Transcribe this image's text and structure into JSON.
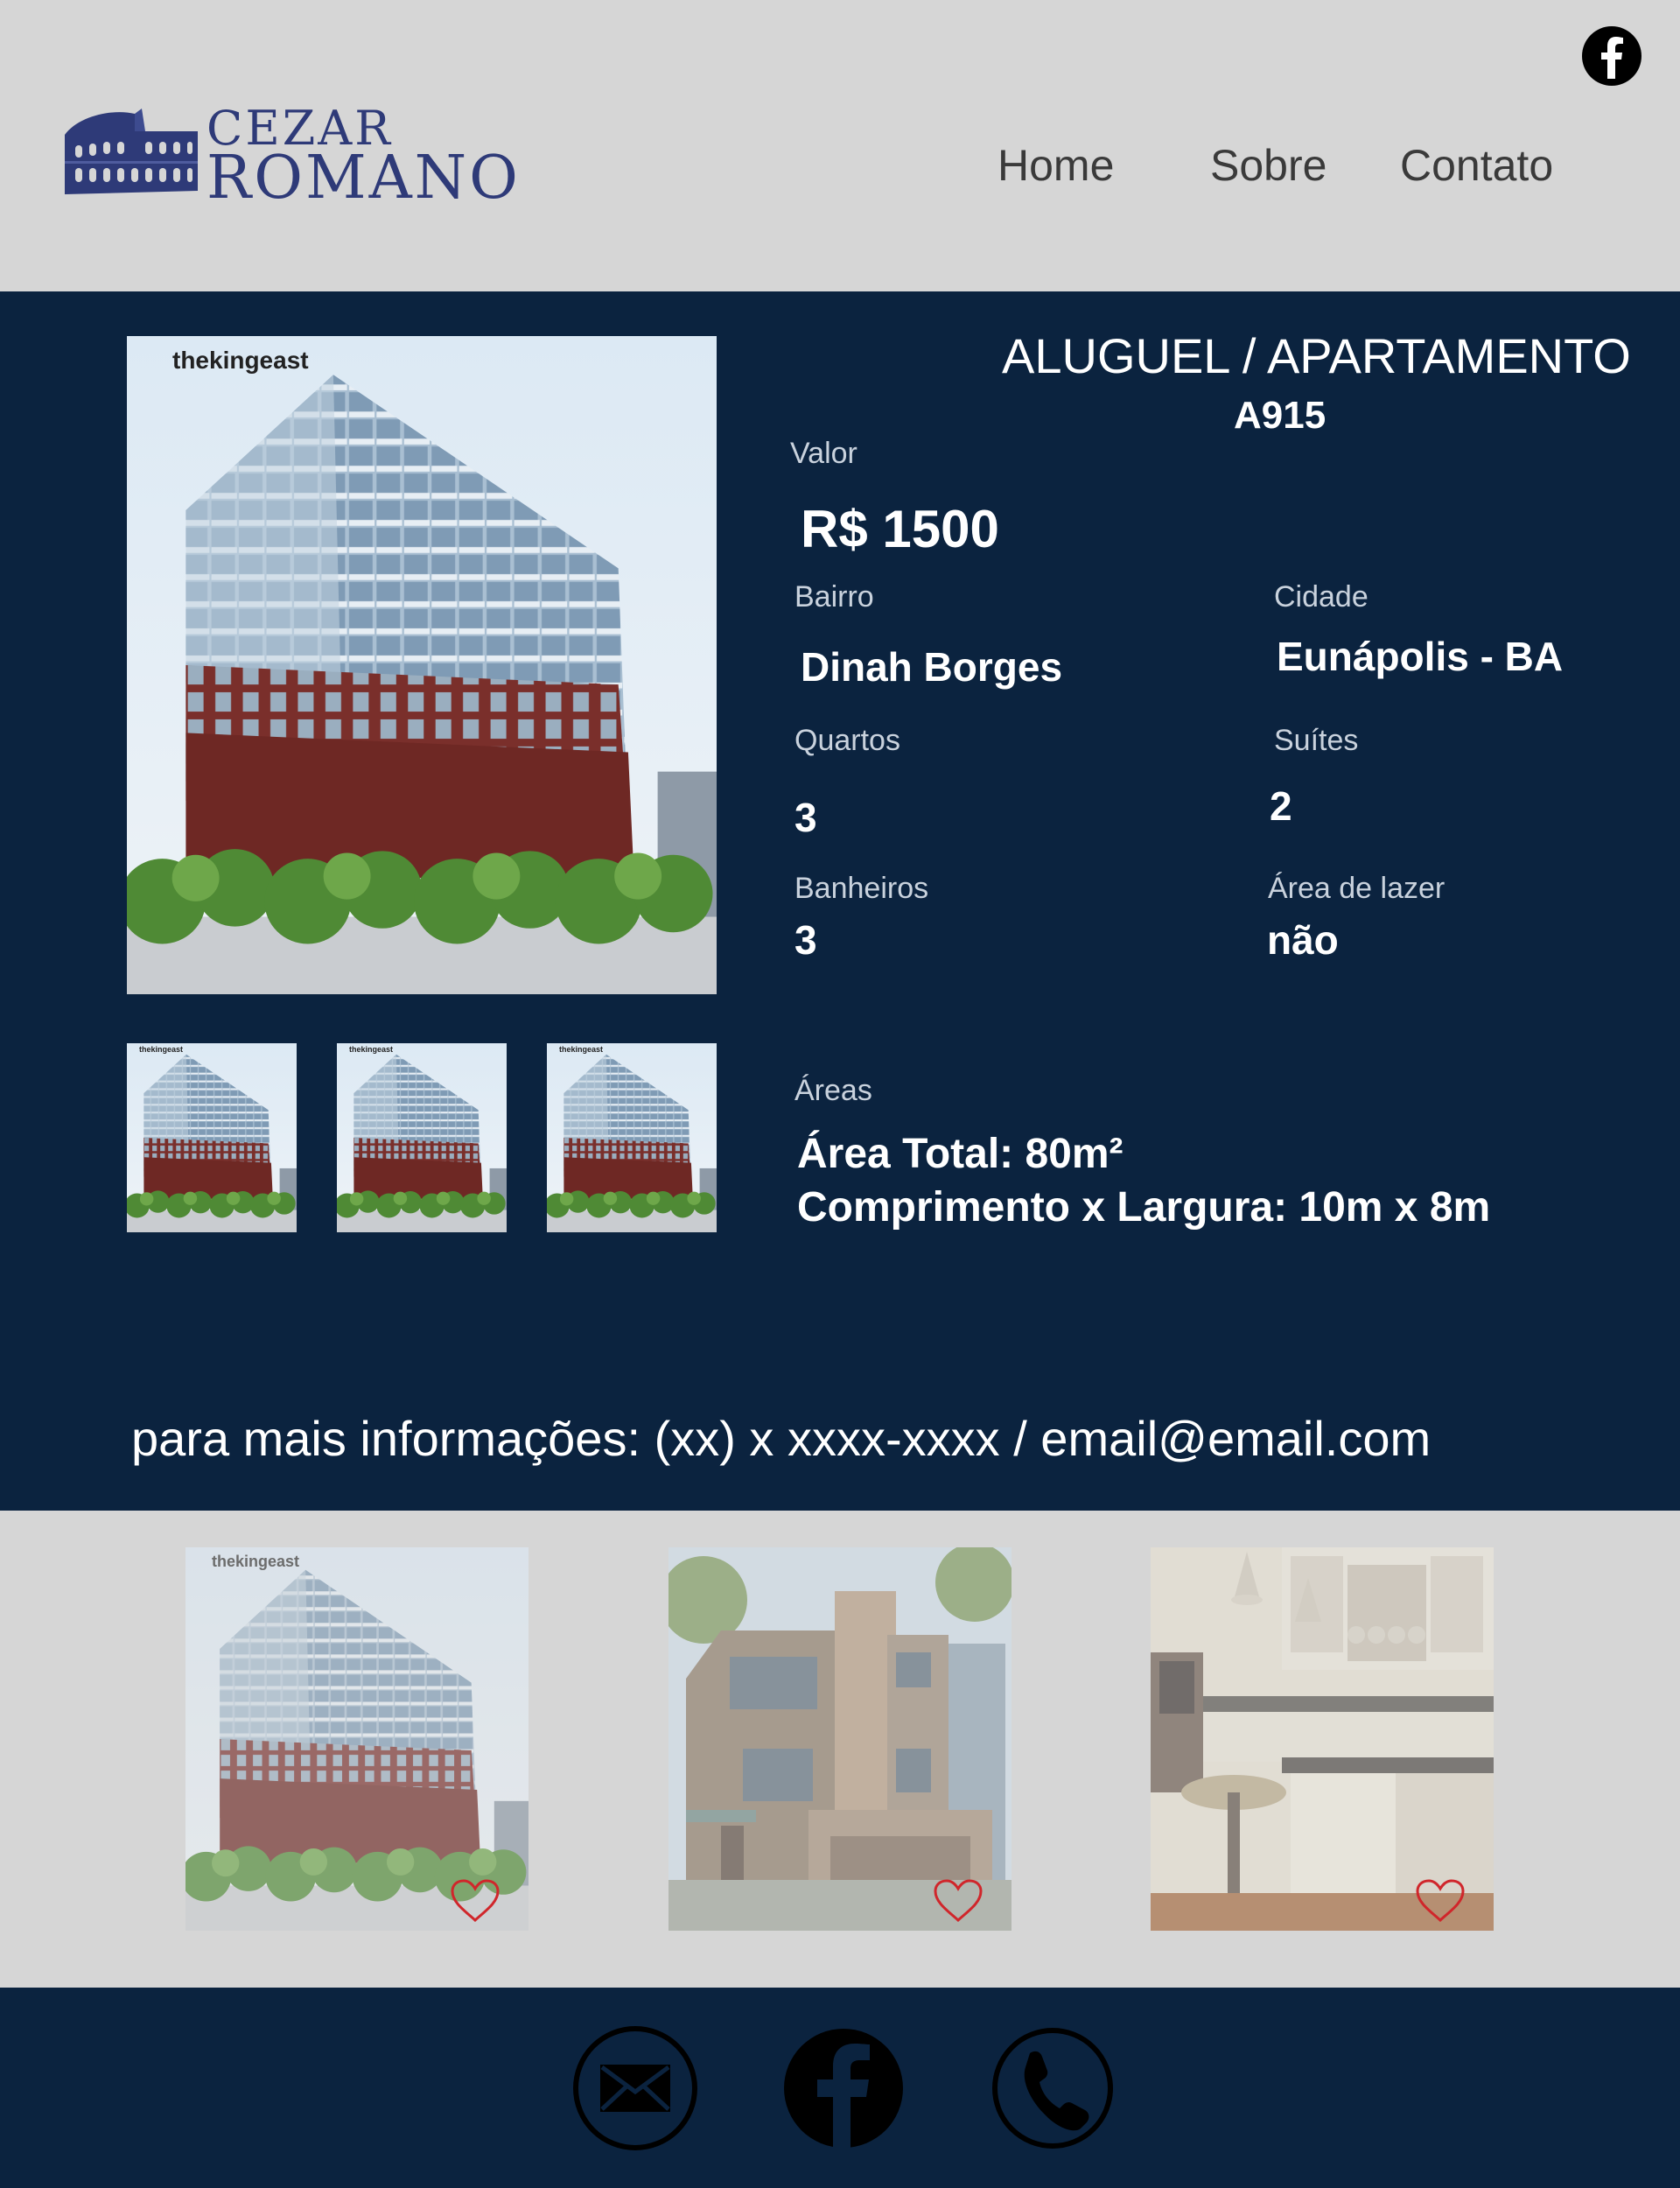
{
  "header": {
    "brand": {
      "line1": "CEZAR",
      "line2": "ROMANO"
    },
    "nav": [
      {
        "label": "Home"
      },
      {
        "label": "Sobre"
      },
      {
        "label": "Contato"
      }
    ],
    "social_icon": "facebook-icon"
  },
  "listing": {
    "main_image_caption": "thekingeast",
    "thumb_caption": "thekingeast",
    "title": "ALUGUEL / APARTAMENTO",
    "code": "A915",
    "fields": {
      "valor": {
        "label": "Valor",
        "value": "R$ 1500"
      },
      "bairro": {
        "label": "Bairro",
        "value": "Dinah Borges"
      },
      "cidade": {
        "label": "Cidade",
        "value": "Eunápolis - BA"
      },
      "quartos": {
        "label": "Quartos",
        "value": "3"
      },
      "suites": {
        "label": "Suítes",
        "value": "2"
      },
      "banheiros": {
        "label": "Banheiros",
        "value": "3"
      },
      "area_lazer": {
        "label": "Área de lazer",
        "value": "não"
      },
      "areas": {
        "label": "Áreas",
        "total": "Área Total: 80m²",
        "dimensions": "Comprimento x Largura: 10m x 8m"
      }
    },
    "contact": "para mais informações: (xx) x xxxx-xxxx / email@email.com"
  },
  "gallery": {
    "card1_caption": "thekingeast",
    "heart_icon": "heart-icon",
    "heart_color": "#d0262b"
  },
  "footer": {
    "icons": [
      "mail-icon",
      "facebook-icon",
      "phone-icon"
    ]
  },
  "colors": {
    "panel": "#0b233f",
    "background": "#d6d6d6",
    "brand": "#2e3a78",
    "text_muted": "#c9d2dd"
  }
}
